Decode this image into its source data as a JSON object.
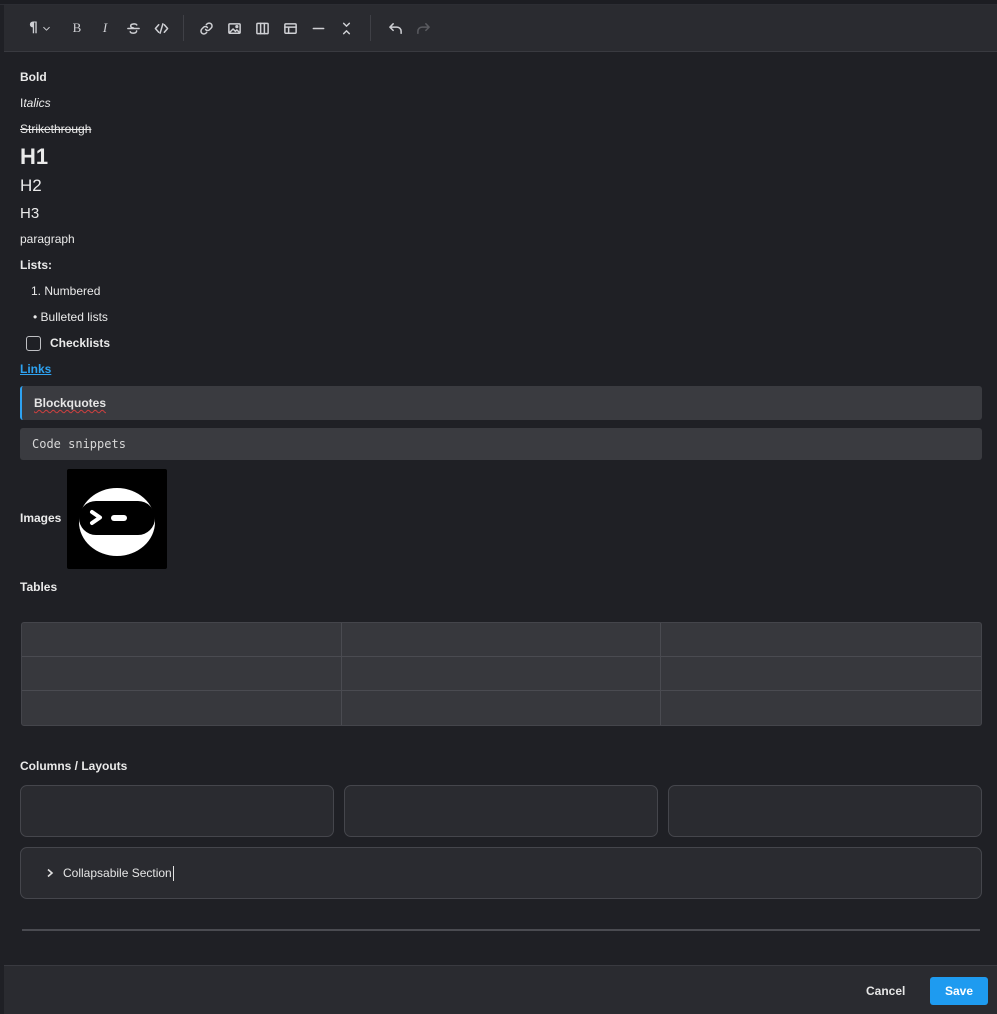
{
  "toolbar": {
    "paragraph_icon": "¶",
    "bold_icon": "B",
    "italic_icon": "I"
  },
  "content": {
    "bold": "Bold",
    "italic_prefix": "I",
    "italic_rest": "talics",
    "strike": "Strikethrough",
    "h1": "H1",
    "h2": "H2",
    "h3": "H3",
    "paragraph": "paragraph",
    "lists_label": "Lists:",
    "numbered": "1. Numbered",
    "bulleted": "• Bulleted lists",
    "checklists": "Checklists",
    "links": "Links",
    "blockquote": "Blockquotes",
    "code": "Code snippets",
    "images_label": "Images",
    "tables_label": "Tables",
    "columns_label": "Columns / Layouts",
    "collapsible": "Collapsabile Section"
  },
  "footer": {
    "cancel": "Cancel",
    "save": "Save"
  },
  "colors": {
    "accent": "#1e9bf0",
    "link": "#2ea3f2",
    "background": "#1f2025"
  }
}
